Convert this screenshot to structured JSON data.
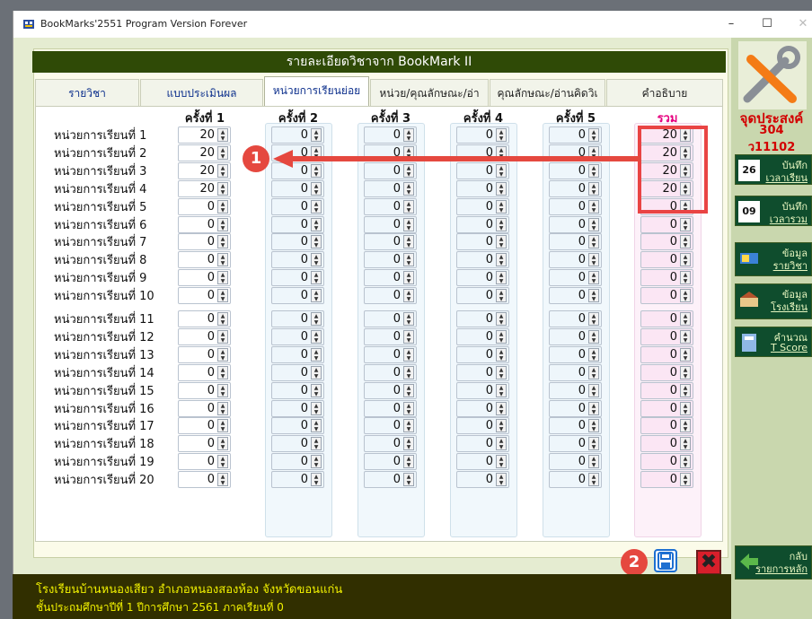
{
  "window": {
    "title": "BookMarks'2551 Program Version Forever",
    "min_glyph": "–",
    "max_glyph": "☐",
    "close_glyph": "✕"
  },
  "header": {
    "title": "รายละเอียดวิชาจาก BookMark II"
  },
  "tabs": [
    {
      "label": "รายวิชา",
      "active": false
    },
    {
      "label": "แบบประเมินผล",
      "active": false
    },
    {
      "label": "หน่วยการเรียนย่อย",
      "active": true
    },
    {
      "label": "หน่วย/คุณลักษณะ/อ่า",
      "active": false
    },
    {
      "label": "คุณลักษณะ/อ่านคิดวิเ",
      "active": false
    },
    {
      "label": "คำอธิบาย",
      "active": false
    }
  ],
  "columns": [
    "ครั้งที่ 1",
    "ครั้งที่ 2",
    "ครั้งที่ 3",
    "ครั้งที่ 4",
    "ครั้งที่ 5",
    "รวม"
  ],
  "rows": [
    {
      "label": "หน่วยการเรียนที่ 1",
      "values": [
        "20",
        "0",
        "0",
        "0",
        "0",
        "20"
      ]
    },
    {
      "label": "หน่วยการเรียนที่ 2",
      "values": [
        "20",
        "0",
        "0",
        "0",
        "0",
        "20"
      ]
    },
    {
      "label": "หน่วยการเรียนที่ 3",
      "values": [
        "20",
        "0",
        "0",
        "0",
        "0",
        "20"
      ]
    },
    {
      "label": "หน่วยการเรียนที่ 4",
      "values": [
        "20",
        "0",
        "0",
        "0",
        "0",
        "20"
      ]
    },
    {
      "label": "หน่วยการเรียนที่ 5",
      "values": [
        "0",
        "0",
        "0",
        "0",
        "0",
        "0"
      ]
    },
    {
      "label": "หน่วยการเรียนที่ 6",
      "values": [
        "0",
        "0",
        "0",
        "0",
        "0",
        "0"
      ]
    },
    {
      "label": "หน่วยการเรียนที่ 7",
      "values": [
        "0",
        "0",
        "0",
        "0",
        "0",
        "0"
      ]
    },
    {
      "label": "หน่วยการเรียนที่ 8",
      "values": [
        "0",
        "0",
        "0",
        "0",
        "0",
        "0"
      ]
    },
    {
      "label": "หน่วยการเรียนที่ 9",
      "values": [
        "0",
        "0",
        "0",
        "0",
        "0",
        "0"
      ]
    },
    {
      "label": "หน่วยการเรียนที่ 10",
      "values": [
        "0",
        "0",
        "0",
        "0",
        "0",
        "0"
      ]
    },
    {
      "label": "หน่วยการเรียนที่ 11",
      "values": [
        "0",
        "0",
        "0",
        "0",
        "0",
        "0"
      ]
    },
    {
      "label": "หน่วยการเรียนที่ 12",
      "values": [
        "0",
        "0",
        "0",
        "0",
        "0",
        "0"
      ]
    },
    {
      "label": "หน่วยการเรียนที่ 13",
      "values": [
        "0",
        "0",
        "0",
        "0",
        "0",
        "0"
      ]
    },
    {
      "label": "หน่วยการเรียนที่ 14",
      "values": [
        "0",
        "0",
        "0",
        "0",
        "0",
        "0"
      ]
    },
    {
      "label": "หน่วยการเรียนที่ 15",
      "values": [
        "0",
        "0",
        "0",
        "0",
        "0",
        "0"
      ]
    },
    {
      "label": "หน่วยการเรียนที่ 16",
      "values": [
        "0",
        "0",
        "0",
        "0",
        "0",
        "0"
      ]
    },
    {
      "label": "หน่วยการเรียนที่ 17",
      "values": [
        "0",
        "0",
        "0",
        "0",
        "0",
        "0"
      ]
    },
    {
      "label": "หน่วยการเรียนที่ 18",
      "values": [
        "0",
        "0",
        "0",
        "0",
        "0",
        "0"
      ]
    },
    {
      "label": "หน่วยการเรียนที่ 19",
      "values": [
        "0",
        "0",
        "0",
        "0",
        "0",
        "0"
      ]
    },
    {
      "label": "หน่วยการเรียนที่ 20",
      "values": [
        "0",
        "0",
        "0",
        "0",
        "0",
        "0"
      ]
    }
  ],
  "annotations": {
    "badge_1": "1",
    "badge_2": "2"
  },
  "actions": {
    "save_icon": "save-icon",
    "cancel_glyph": "✖"
  },
  "footer": {
    "line1": "โรงเรียนบ้านหนองเสียว อำเภอหนองสองห้อง จังหวัดขอนแก่น",
    "line2": "ชั้นประถมศึกษาปีที่ 1 ปีการศึกษา 2561 ภาคเรียนที่ 0"
  },
  "sidebar": {
    "title": "จุดประสงค์",
    "code1": "304",
    "code2": "ว11102",
    "buttons": [
      {
        "line1": "บันทึก",
        "line2": "เวลาเรียน",
        "icon": "calendar-26-icon",
        "icon_text": "26"
      },
      {
        "line1": "บันทึก",
        "line2": "เวลารวม",
        "icon": "calendar-09-icon",
        "icon_text": "09"
      },
      {
        "line1": "ข้อมูล",
        "line2": "รายวิชา",
        "icon": "book-icon"
      },
      {
        "line1": "ข้อมูล",
        "line2": "โรงเรียน",
        "icon": "school-icon"
      },
      {
        "line1": "คำนวณ",
        "line2": "T Score",
        "icon": "calculator-icon"
      },
      {
        "line1": "กลับ",
        "line2": "รายการหลัก",
        "icon": "back-arrow-icon"
      }
    ]
  },
  "colors": {
    "header_bg": "#2f4a06",
    "accent_red": "#e5483f",
    "total_pink": "#e6007e",
    "footer_text": "#f2f200"
  }
}
